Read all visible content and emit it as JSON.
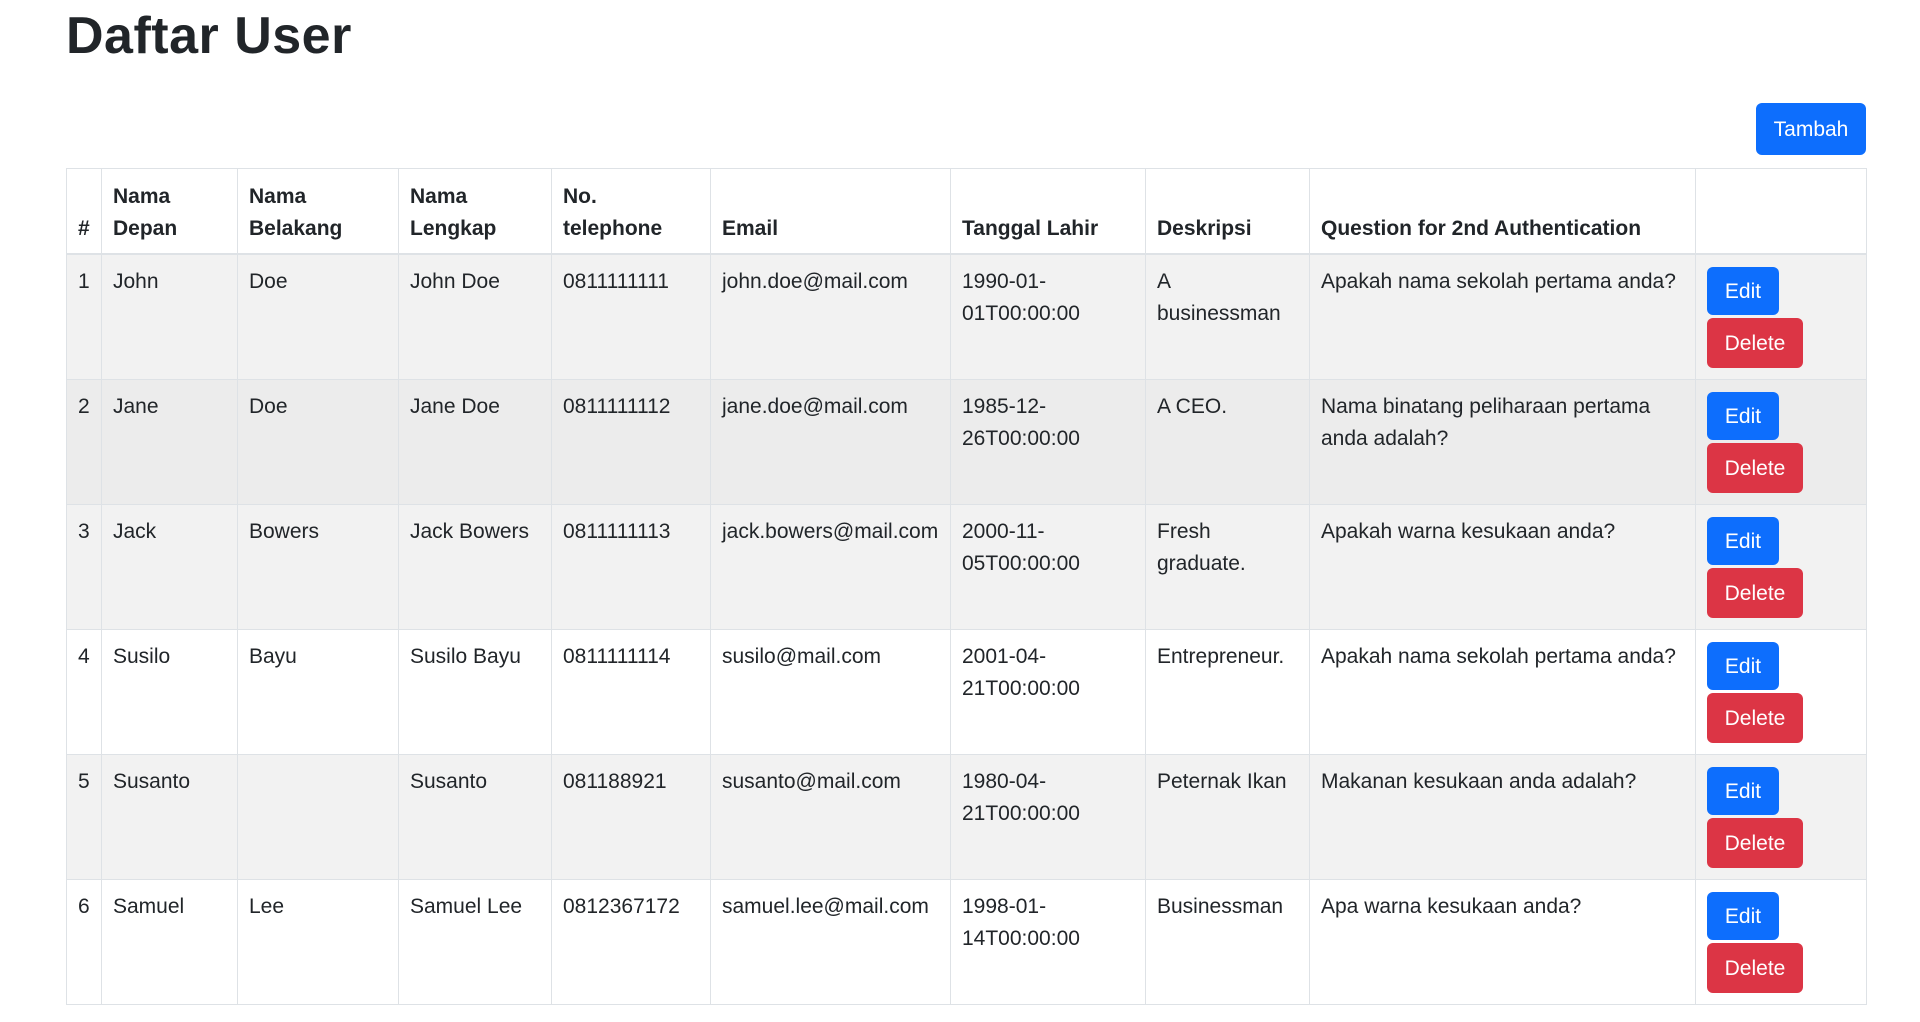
{
  "page": {
    "title": "Daftar User",
    "add_button_label": "Tambah"
  },
  "colors": {
    "primary": "#0d6efd",
    "danger": "#dc3545",
    "stripe": "#f2f2f2",
    "border": "#dee2e6"
  },
  "table": {
    "headers": [
      "#",
      "Nama Depan",
      "Nama Belakang",
      "Nama Lengkap",
      "No. telephone",
      "Email",
      "Tanggal Lahir",
      "Deskripsi",
      "Question for 2nd Authentication",
      ""
    ],
    "edit_label": "Edit",
    "delete_label": "Delete",
    "rows": [
      {
        "no": "1",
        "first": "John",
        "last": "Doe",
        "full": "John Doe",
        "phone": "0811111111",
        "email": "john.doe@mail.com",
        "birth": "1990-01-01T00:00:00",
        "desc": "A businessman",
        "question": "Apakah nama sekolah pertama anda?"
      },
      {
        "no": "2",
        "first": "Jane",
        "last": "Doe",
        "full": "Jane Doe",
        "phone": "0811111112",
        "email": "jane.doe@mail.com",
        "birth": "1985-12-26T00:00:00",
        "desc": "A CEO.",
        "question": "Nama binatang peliharaan pertama anda adalah?"
      },
      {
        "no": "3",
        "first": "Jack",
        "last": "Bowers",
        "full": "Jack Bowers",
        "phone": "0811111113",
        "email": "jack.bowers@mail.com",
        "birth": "2000-11-05T00:00:00",
        "desc": "Fresh graduate.",
        "question": "Apakah warna kesukaan anda?"
      },
      {
        "no": "4",
        "first": "Susilo",
        "last": "Bayu",
        "full": "Susilo Bayu",
        "phone": "0811111114",
        "email": "susilo@mail.com",
        "birth": "2001-04-21T00:00:00",
        "desc": "Entrepreneur.",
        "question": "Apakah nama sekolah pertama anda?"
      },
      {
        "no": "5",
        "first": "Susanto",
        "last": "",
        "full": "Susanto",
        "phone": "081188921",
        "email": "susanto@mail.com",
        "birth": "1980-04-21T00:00:00",
        "desc": "Peternak Ikan",
        "question": "Makanan kesukaan anda adalah?"
      },
      {
        "no": "6",
        "first": "Samuel",
        "last": "Lee",
        "full": "Samuel Lee",
        "phone": "0812367172",
        "email": "samuel.lee@mail.com",
        "birth": "1998-01-14T00:00:00",
        "desc": "Businessman",
        "question": "Apa warna kesukaan anda?"
      }
    ]
  }
}
